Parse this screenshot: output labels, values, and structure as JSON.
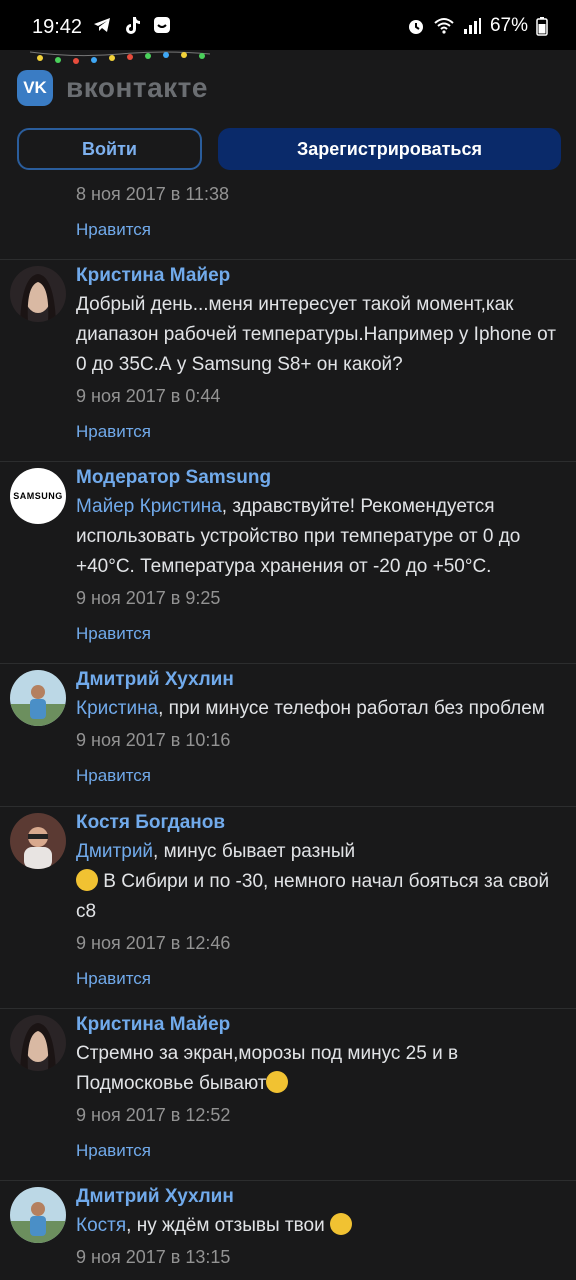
{
  "status": {
    "time": "19:42",
    "battery": "67%"
  },
  "header": {
    "brand": "вконтакте",
    "logo_text": "VK",
    "login_label": "Войти",
    "register_label": "Зарегистрироваться"
  },
  "top_partial": {
    "date": "8 ноя 2017 в 11:38",
    "like": "Нравится"
  },
  "comments": [
    {
      "author": "Кристина Майер",
      "mention": "",
      "text": "Добрый день...меня интересует такой момент,как диапазон рабочей температуры.Например у Iphone от 0 до 35С.А у Samsung S8+ он какой?",
      "date": "9 ноя 2017 в 0:44",
      "like": "Нравится"
    },
    {
      "author": "Модератор Samsung",
      "mention": "Майер Кристина",
      "text": ", здравствуйте! Рекомендуется использовать устройство при температуре от 0 до +40°С. Температура хранения от -20 до +50°С.",
      "date": "9 ноя 2017 в 9:25",
      "like": "Нравится",
      "avatar_text": "SAMSUNG"
    },
    {
      "author": "Дмитрий Хухлин",
      "mention": "Кристина",
      "text": ", при минусе телефон работал без проблем",
      "date": "9 ноя 2017 в 10:16",
      "like": "Нравится"
    },
    {
      "author": "Костя Богданов",
      "mention": "Дмитрий",
      "text": ", минус бывает разный",
      "text2": " В Сибири и по -30, немного начал бояться за свой с8",
      "date": "9 ноя 2017 в 12:46",
      "like": "Нравится"
    },
    {
      "author": "Кристина Майер",
      "mention": "",
      "text": "Стремно за экран,морозы под минус 25 и в Подмосковье бывают",
      "date": "9 ноя 2017 в 12:52",
      "like": "Нравится"
    },
    {
      "author": "Дмитрий Хухлин",
      "mention": "Костя",
      "text": ", ну ждём отзывы твои ",
      "date": "9 ноя 2017 в 13:15",
      "like": ""
    }
  ]
}
